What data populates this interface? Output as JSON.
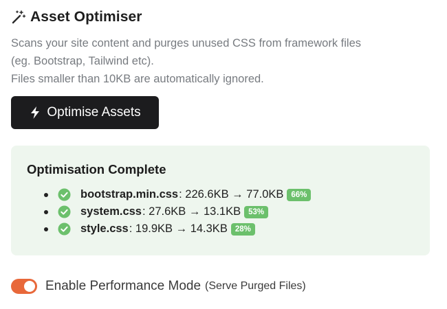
{
  "header": {
    "icon": "magic-wand-icon",
    "title": "Asset Optimiser"
  },
  "description": {
    "line1": "Scans your site content and purges unused CSS from framework files",
    "line2": "(eg. Bootstrap, Tailwind etc).",
    "line3": "Files smaller than 10KB are automatically ignored."
  },
  "action": {
    "icon": "lightning-bolt-icon",
    "label": "Optimise Assets"
  },
  "result": {
    "title": "Optimisation Complete",
    "files": [
      {
        "name": "bootstrap.min.css",
        "sizes": ": 226.6KB → 77.0KB",
        "percent": "66%"
      },
      {
        "name": "system.css",
        "sizes": ": 27.6KB → 13.1KB",
        "percent": "53%"
      },
      {
        "name": "style.css",
        "sizes": ": 19.9KB → 14.3KB",
        "percent": "28%"
      }
    ],
    "check_icon": "check-circle-icon",
    "badge_color": "#6cc06c",
    "background_color": "#eef6ee"
  },
  "performance": {
    "label": "Enable Performance Mode",
    "sublabel": "(Serve Purged Files)",
    "enabled": true,
    "toggle_color": "#e8683a"
  }
}
